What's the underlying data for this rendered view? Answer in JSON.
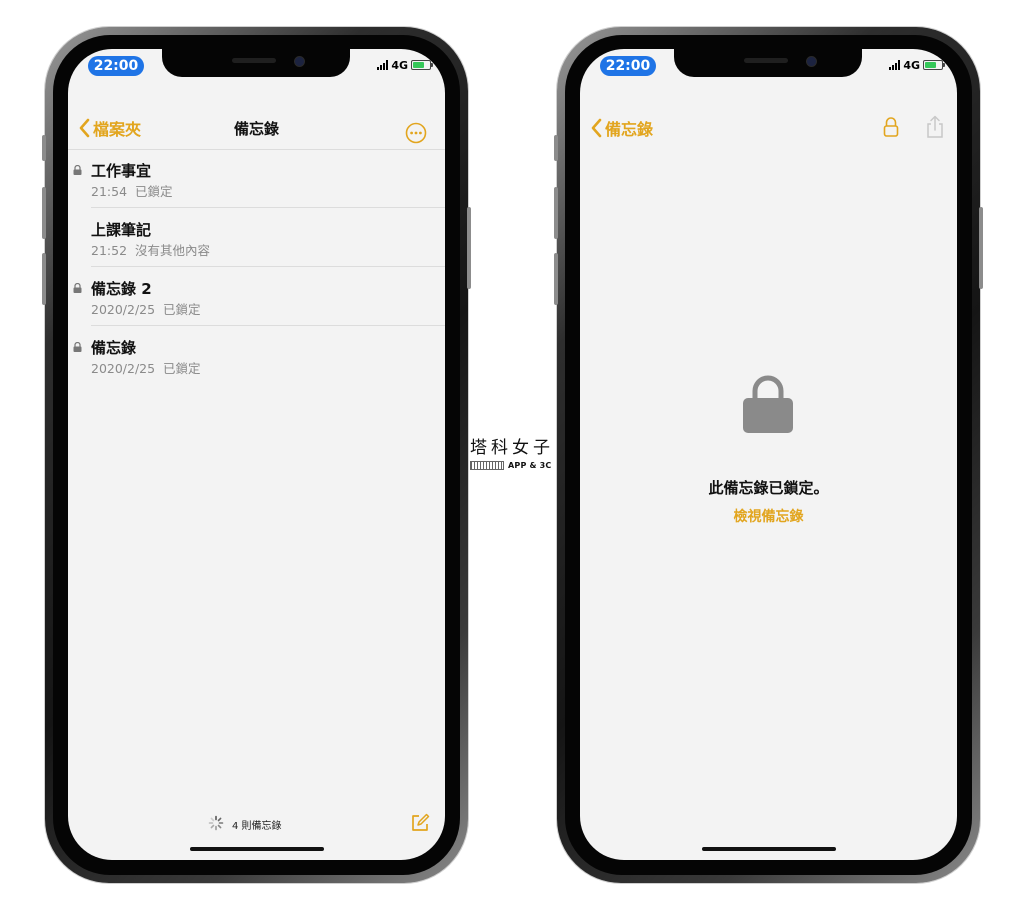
{
  "left_screen": {
    "status": {
      "time": "22:00",
      "network": "4G"
    },
    "nav": {
      "back_label": "檔案夾",
      "title": "備忘錄"
    },
    "notes": [
      {
        "title": "工作事宜",
        "subtitle": "21:54  已鎖定",
        "locked": true
      },
      {
        "title": "上課筆記",
        "subtitle": "21:52  沒有其他內容",
        "locked": false
      },
      {
        "title": "備忘錄 2",
        "subtitle": "2020/2/25  已鎖定",
        "locked": true
      },
      {
        "title": "備忘錄",
        "subtitle": "2020/2/25  已鎖定",
        "locked": true
      }
    ],
    "footer": {
      "count_label": "4 則備忘錄"
    }
  },
  "right_screen": {
    "status": {
      "time": "22:00",
      "network": "4G"
    },
    "nav": {
      "back_label": "備忘錄"
    },
    "locked_message": "此備忘錄已鎖定。",
    "view_link": "檢視備忘錄"
  },
  "watermark": {
    "title": "塔科女子",
    "subtitle": "APP & 3C"
  },
  "colors": {
    "accent": "#e2a51e",
    "time_pill": "#1f74e6",
    "screen_bg": "#f3f3f3",
    "battery": "#35c759"
  },
  "icons": {
    "left_nav": [
      "chevron-left-icon",
      "more-options-icon"
    ],
    "left_footer": [
      "loading-spinner-icon",
      "compose-icon"
    ],
    "right_nav": [
      "chevron-left-icon",
      "lock-icon",
      "share-icon"
    ],
    "right_main": [
      "lock-icon"
    ]
  }
}
